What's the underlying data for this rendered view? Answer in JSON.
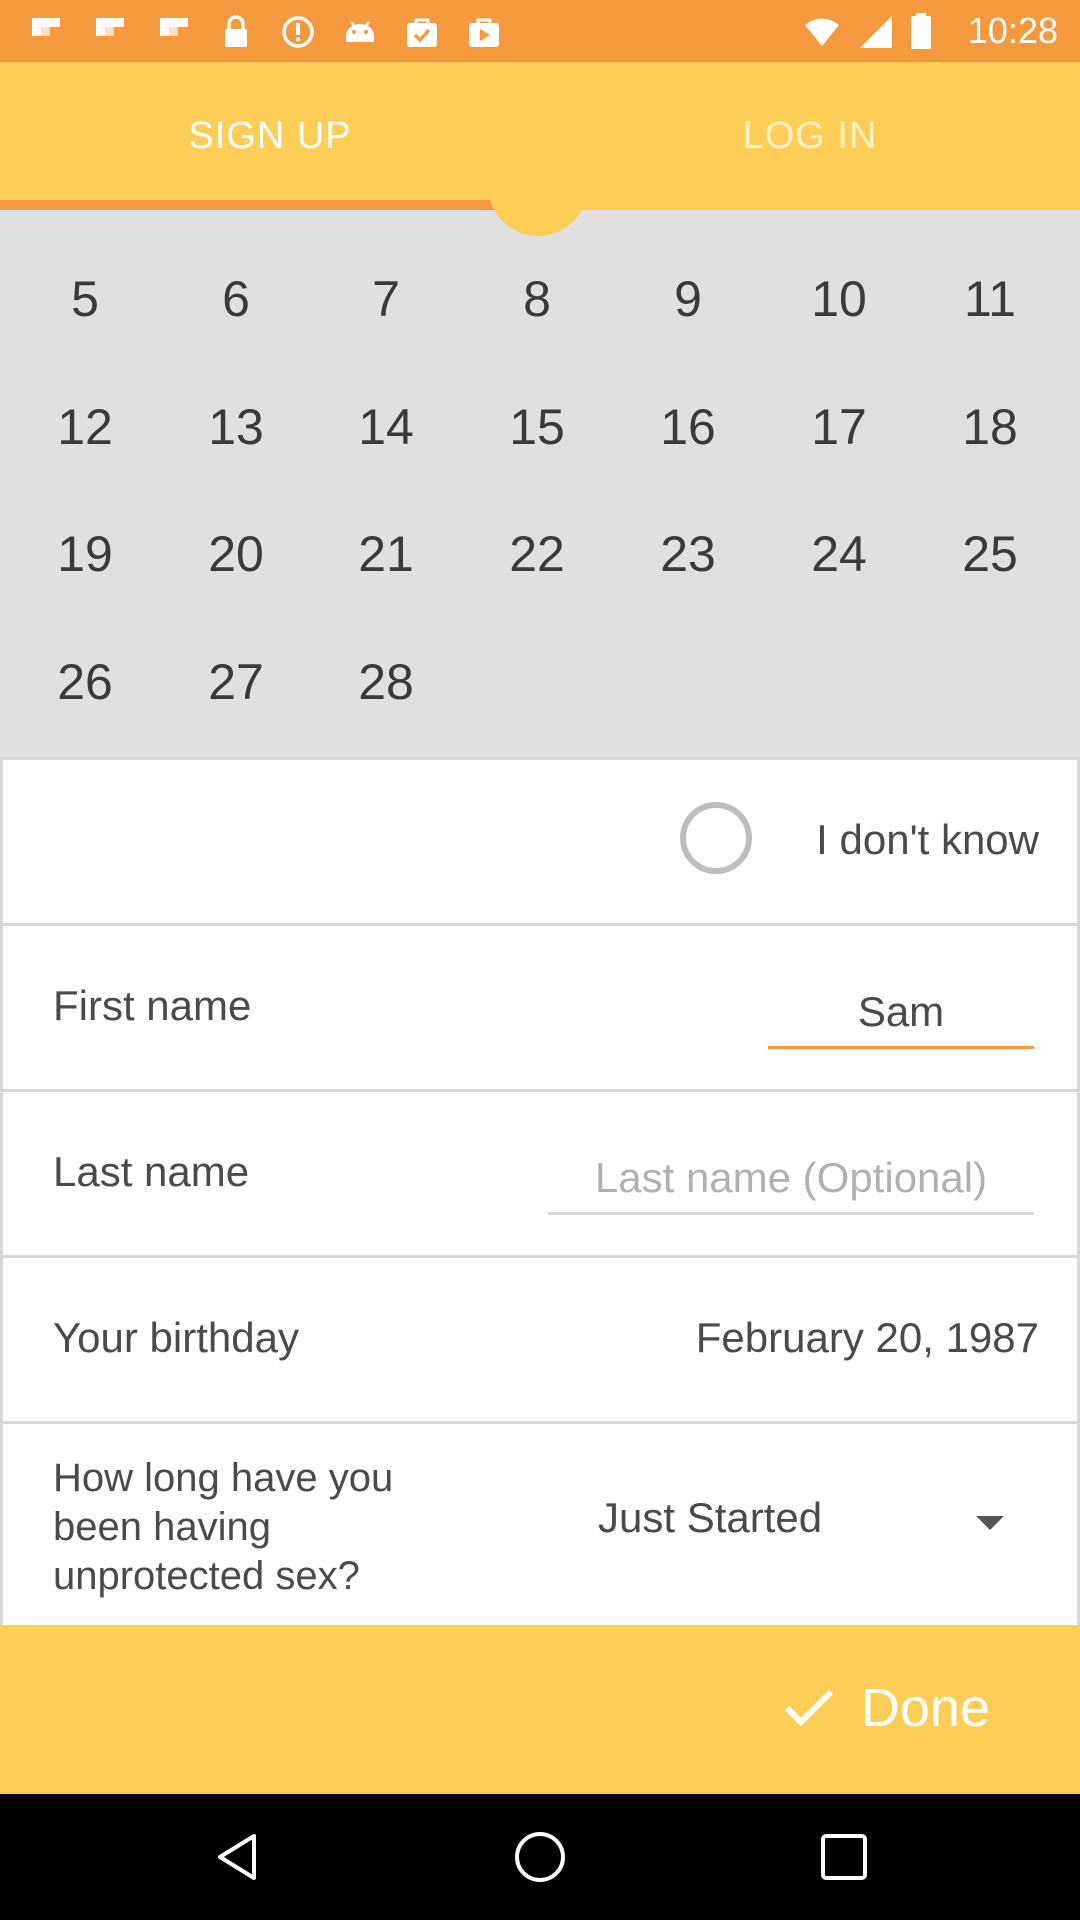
{
  "status_bar": {
    "time": "10:28",
    "notification_icons": [
      "flipboard-icon",
      "flipboard-icon",
      "flipboard-icon",
      "lock-icon",
      "at-icon",
      "android-icon",
      "bag-check-icon",
      "bag-play-icon"
    ],
    "system_icons": [
      "wifi-icon",
      "signal-icon",
      "battery-icon"
    ]
  },
  "tabs": {
    "signup_label": "SIGN UP",
    "login_label": "LOG IN",
    "active": "signup"
  },
  "calendar": {
    "rows": [
      [
        "5",
        "6",
        "7",
        "8",
        "9",
        "10",
        "11"
      ],
      [
        "12",
        "13",
        "14",
        "15",
        "16",
        "17",
        "18"
      ],
      [
        "19",
        "20",
        "21",
        "22",
        "23",
        "24",
        "25"
      ],
      [
        "26",
        "27",
        "28"
      ]
    ]
  },
  "form": {
    "unknown_option_label": "I don't know",
    "first_name": {
      "label": "First name",
      "value": "Sam"
    },
    "last_name": {
      "label": "Last name",
      "value": "",
      "placeholder": "Last name (Optional)"
    },
    "birthday": {
      "label": "Your birthday",
      "value": "February 20, 1987"
    },
    "duration": {
      "question": "How long have you been having unprotected sex?",
      "selected": "Just Started"
    }
  },
  "done_label": "Done",
  "colors": {
    "status_bar": "#f5993e",
    "accent_yellow": "#fdce57",
    "accent_orange": "#f5993e",
    "calendar_bg": "#e0e0e0"
  }
}
